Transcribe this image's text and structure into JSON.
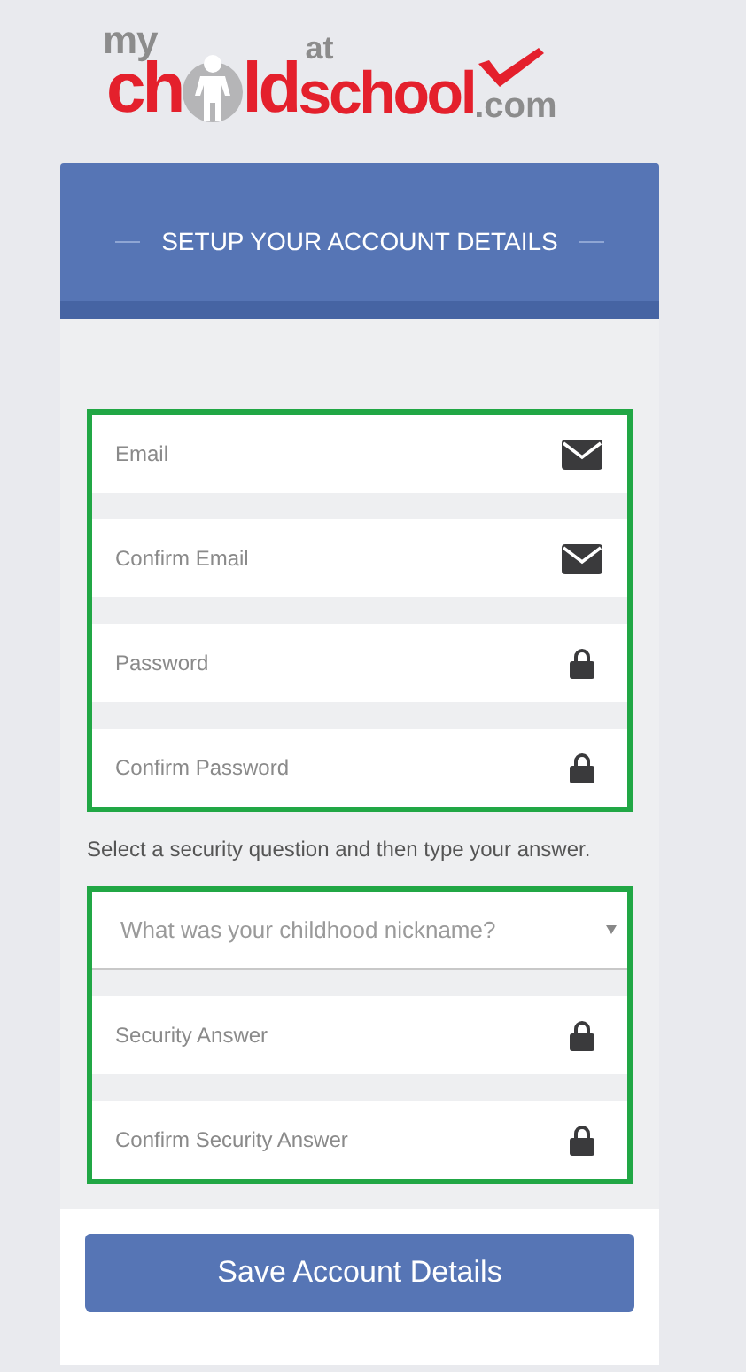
{
  "logo": {
    "my": "my",
    "ch": "ch",
    "ld": "ld",
    "at": "at",
    "school": "school",
    "com": ".com"
  },
  "header": {
    "title": "SETUP YOUR ACCOUNT DETAILS"
  },
  "account_fields": [
    {
      "placeholder": "Email",
      "kind": "email"
    },
    {
      "placeholder": "Confirm Email",
      "kind": "email"
    },
    {
      "placeholder": "Password",
      "kind": "password"
    },
    {
      "placeholder": "Confirm Password",
      "kind": "password"
    }
  ],
  "security_hint": "Select a security question and then type your answer.",
  "security_question": {
    "placeholder": "What was your childhood nickname?"
  },
  "security_fields": [
    {
      "placeholder": "Security Answer",
      "kind": "password"
    },
    {
      "placeholder": "Confirm Security Answer",
      "kind": "password"
    }
  ],
  "save_button": "Save Account Details"
}
